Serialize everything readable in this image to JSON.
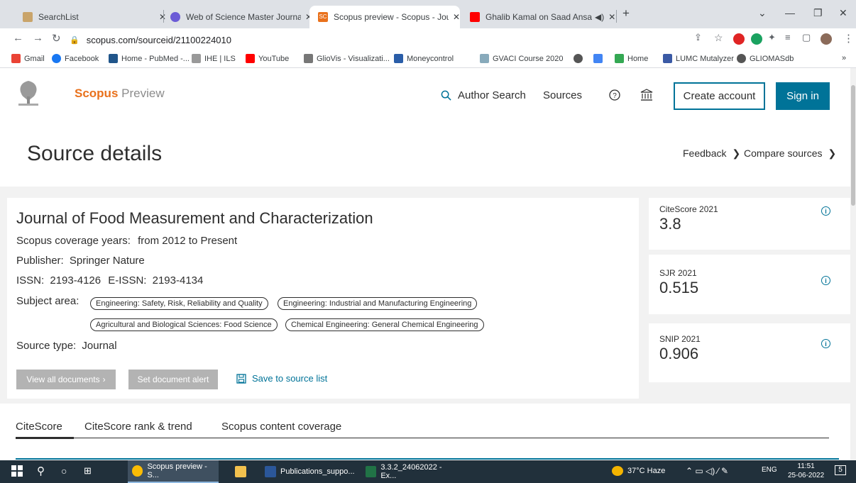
{
  "browser": {
    "tabs": [
      {
        "title": "SearchList"
      },
      {
        "title": "Web of Science Master Journal Li"
      },
      {
        "title": "Scopus preview - Scopus - Journ"
      },
      {
        "title": "Ghalib Kamal on Saad Ansari"
      }
    ],
    "url": "scopus.com/sourceid/21100224010",
    "bookmarks": [
      "Gmail",
      "Facebook",
      "Home - PubMed -...",
      "IHE | ILS",
      "YouTube",
      "GlioVis - Visualizati...",
      "Moneycontrol",
      "GVACI Course 2020",
      "Home",
      "LUMC Mutalyzer",
      "GLIOMASdb"
    ]
  },
  "header": {
    "brand": "Scopus",
    "brand_suffix": "Preview",
    "nav": {
      "author_search": "Author Search",
      "sources": "Sources"
    },
    "create_account": "Create account",
    "sign_in": "Sign in"
  },
  "page": {
    "title": "Source details",
    "feedback": "Feedback",
    "compare": "Compare sources"
  },
  "journal": {
    "title": "Journal of Food Measurement and Characterization",
    "coverage_label": "Scopus coverage years:",
    "coverage_value": "from 2012 to Present",
    "publisher_label": "Publisher:",
    "publisher_value": "Springer Nature",
    "issn_label": "ISSN:",
    "issn_value": "2193-4126",
    "eissn_label": "E-ISSN:",
    "eissn_value": "2193-4134",
    "subject_label": "Subject area:",
    "subjects": [
      "Engineering: Safety, Risk, Reliability and Quality",
      "Engineering: Industrial and Manufacturing Engineering",
      "Agricultural and Biological Sciences: Food Science",
      "Chemical Engineering: General Chemical Engineering"
    ],
    "source_type_label": "Source type:",
    "source_type_value": "Journal",
    "view_all": "View all documents",
    "set_alert": "Set document alert",
    "save_to_list": "Save to source list"
  },
  "metrics": [
    {
      "label": "CiteScore 2021",
      "value": "3.8"
    },
    {
      "label": "SJR 2021",
      "value": "0.515"
    },
    {
      "label": "SNIP 2021",
      "value": "0.906"
    }
  ],
  "tabs": [
    "CiteScore",
    "CiteScore rank & trend",
    "Scopus content coverage"
  ],
  "taskbar": {
    "apps": [
      "Scopus preview - S...",
      "Publications_suppo...",
      "3.3.2_24062022 - Ex..."
    ],
    "weather": "37°C  Haze",
    "lang": "ENG",
    "time": "11:51",
    "date": "25-06-2022",
    "notif": "5"
  }
}
